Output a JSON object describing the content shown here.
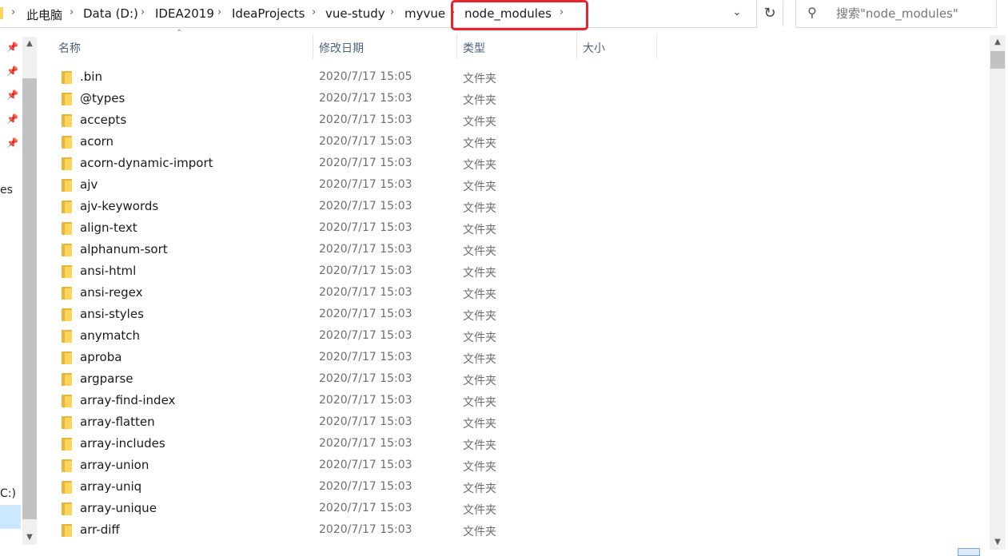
{
  "breadcrumb": {
    "items": [
      "此电脑",
      "Data (D:)",
      "IDEA2019",
      "IdeaProjects",
      "vue-study",
      "myvue",
      "node_modules"
    ],
    "separator": "›"
  },
  "search": {
    "placeholder": "搜索\"node_modules\""
  },
  "nav": {
    "fragment_es": "es",
    "fragment_c": "C:)"
  },
  "columns": {
    "name": "名称",
    "date": "修改日期",
    "type": "类型",
    "size": "大小"
  },
  "files": [
    {
      "name": ".bin",
      "date": "2020/7/17 15:05",
      "type": "文件夹"
    },
    {
      "name": "@types",
      "date": "2020/7/17 15:03",
      "type": "文件夹"
    },
    {
      "name": "accepts",
      "date": "2020/7/17 15:03",
      "type": "文件夹"
    },
    {
      "name": "acorn",
      "date": "2020/7/17 15:03",
      "type": "文件夹"
    },
    {
      "name": "acorn-dynamic-import",
      "date": "2020/7/17 15:03",
      "type": "文件夹"
    },
    {
      "name": "ajv",
      "date": "2020/7/17 15:03",
      "type": "文件夹"
    },
    {
      "name": "ajv-keywords",
      "date": "2020/7/17 15:03",
      "type": "文件夹"
    },
    {
      "name": "align-text",
      "date": "2020/7/17 15:03",
      "type": "文件夹"
    },
    {
      "name": "alphanum-sort",
      "date": "2020/7/17 15:03",
      "type": "文件夹"
    },
    {
      "name": "ansi-html",
      "date": "2020/7/17 15:03",
      "type": "文件夹"
    },
    {
      "name": "ansi-regex",
      "date": "2020/7/17 15:03",
      "type": "文件夹"
    },
    {
      "name": "ansi-styles",
      "date": "2020/7/17 15:03",
      "type": "文件夹"
    },
    {
      "name": "anymatch",
      "date": "2020/7/17 15:03",
      "type": "文件夹"
    },
    {
      "name": "aproba",
      "date": "2020/7/17 15:03",
      "type": "文件夹"
    },
    {
      "name": "argparse",
      "date": "2020/7/17 15:03",
      "type": "文件夹"
    },
    {
      "name": "array-find-index",
      "date": "2020/7/17 15:03",
      "type": "文件夹"
    },
    {
      "name": "array-flatten",
      "date": "2020/7/17 15:03",
      "type": "文件夹"
    },
    {
      "name": "array-includes",
      "date": "2020/7/17 15:03",
      "type": "文件夹"
    },
    {
      "name": "array-union",
      "date": "2020/7/17 15:03",
      "type": "文件夹"
    },
    {
      "name": "array-uniq",
      "date": "2020/7/17 15:03",
      "type": "文件夹"
    },
    {
      "name": "array-unique",
      "date": "2020/7/17 15:03",
      "type": "文件夹"
    },
    {
      "name": "arr-diff",
      "date": "2020/7/17 15:03",
      "type": "文件夹"
    }
  ],
  "colors": {
    "highlight": "#e8232b",
    "folder": "#ffd45a",
    "header_text": "#4c607a"
  }
}
